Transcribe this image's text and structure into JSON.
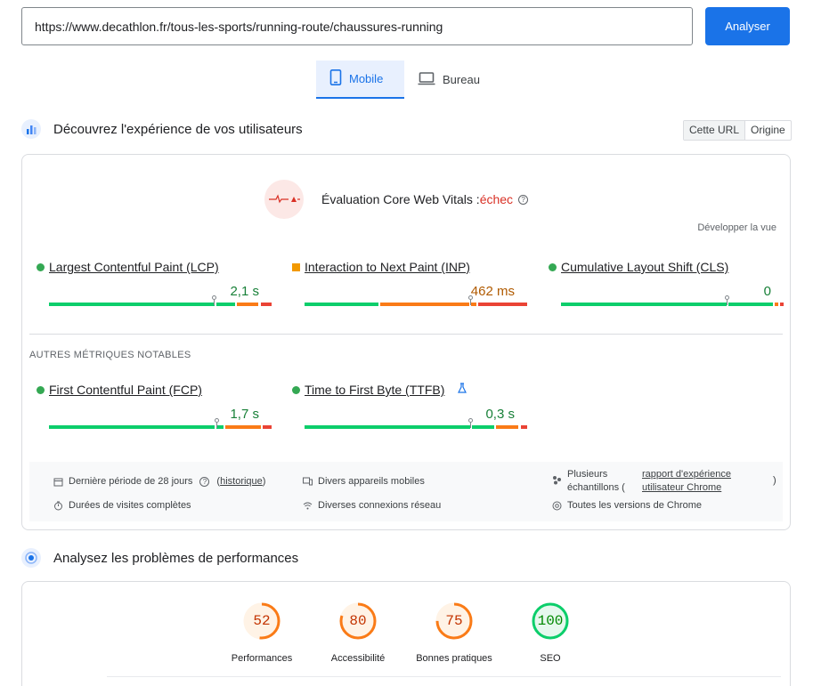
{
  "search": {
    "url": "https://www.decathlon.fr/tous-les-sports/running-route/chaussures-running",
    "analyze_label": "Analyser"
  },
  "device_tabs": {
    "mobile": "Mobile",
    "desktop": "Bureau"
  },
  "field_section": {
    "title": "Découvrez l'expérience de vos utilisateurs",
    "toggle_url": "Cette URL",
    "toggle_origin": "Origine"
  },
  "cwv": {
    "label": "Évaluation Core Web Vitals :",
    "result": "échec",
    "expand": "Développer la vue"
  },
  "metrics": [
    {
      "name": "Largest Contentful Paint (LCP)",
      "value": "2,1 s",
      "status": "good"
    },
    {
      "name": "Interaction to Next Paint (INP)",
      "value": "462 ms",
      "status": "needs-improvement"
    },
    {
      "name": "Cumulative Layout Shift (CLS)",
      "value": "0",
      "status": "good"
    }
  ],
  "other_metrics_label": "AUTRES MÉTRIQUES NOTABLES",
  "other_metrics": [
    {
      "name": "First Contentful Paint (FCP)",
      "value": "1,7 s",
      "status": "good"
    },
    {
      "name": "Time to First Byte (TTFB)",
      "value": "0,3 s",
      "status": "good"
    }
  ],
  "info": {
    "period": "Dernière période de 28 jours",
    "history_link": "historique",
    "visits": "Durées de visites complètes",
    "devices": "Divers appareils mobiles",
    "network": "Diverses connexions réseau",
    "samples_prefix": "Plusieurs échantillons (",
    "crux_link": "rapport d'expérience utilisateur Chrome",
    "samples_suffix": ")",
    "chrome_versions": "Toutes les versions de Chrome"
  },
  "lab_section": {
    "title": "Analysez les problèmes de performances"
  },
  "scores": [
    {
      "label": "Performances",
      "value": "52",
      "color": "#fa7b17"
    },
    {
      "label": "Accessibilité",
      "value": "80",
      "color": "#fa7b17"
    },
    {
      "label": "Bonnes pratiques",
      "value": "75",
      "color": "#fa7b17"
    },
    {
      "label": "SEO",
      "value": "100",
      "color": "#0cce6b"
    }
  ],
  "colors": {
    "accent": "#1a73e8",
    "good": "#0cce6b",
    "average": "#fa7b17",
    "poor": "#ea4335",
    "fail": "#d93025"
  }
}
